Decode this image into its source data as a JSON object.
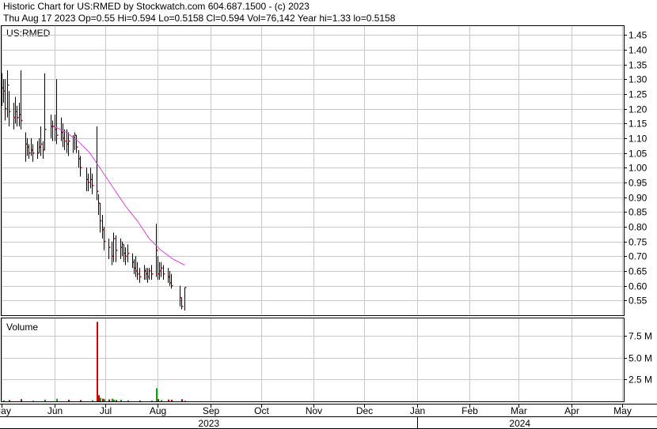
{
  "header": {
    "line1": "Historic Chart for US:RMED by Stockwatch.com 604.687.1500 - (c) 2023",
    "line2": "Thu Aug 17 2023  Op=0.55  Hi=0.594  Lo=0.5158  Cl=0.594  Vol=76,142  Year hi=1.33  lo=0.5158"
  },
  "colors": {
    "background": "#ffffff",
    "grid": "#c8c8c8",
    "candle": "#000000",
    "close_tick": "#cc0000",
    "moving_average": "#e040e0",
    "volume_up": "#cc0000",
    "volume_down": "#00aa00"
  },
  "chart_data": [
    {
      "type": "candlestick",
      "symbol_label": "US:RMED",
      "ylim": [
        0.5,
        1.48
      ],
      "y_ticks": [
        "1.45",
        "1.40",
        "1.35",
        "1.30",
        "1.25",
        "1.20",
        "1.15",
        "1.10",
        "1.05",
        "1.00",
        "0.95",
        "0.90",
        "0.85",
        "0.80",
        "0.75",
        "0.70",
        "0.65",
        "0.60",
        "0.55"
      ],
      "x_months": [
        "May",
        "Jun",
        "Jul",
        "Aug",
        "Sep",
        "Oct",
        "Nov",
        "Dec",
        "Jan",
        "Feb",
        "Mar",
        "Apr",
        "May"
      ],
      "years": [
        "2023",
        "2024"
      ],
      "x_start": "2023-04-30",
      "x_end": "2024-05-01",
      "series": [
        {
          "date": "2023-05-01",
          "high": 1.32,
          "low": 1.21,
          "close": 1.27
        },
        {
          "date": "2023-05-02",
          "high": 1.3,
          "low": 1.22,
          "close": 1.26
        },
        {
          "date": "2023-05-03",
          "high": 1.3,
          "low": 1.16,
          "close": 1.2
        },
        {
          "date": "2023-05-04",
          "high": 1.33,
          "low": 1.17,
          "close": 1.28
        },
        {
          "date": "2023-05-05",
          "high": 1.26,
          "low": 1.14,
          "close": 1.19
        },
        {
          "date": "2023-05-08",
          "high": 1.22,
          "low": 1.13,
          "close": 1.17
        },
        {
          "date": "2023-05-09",
          "high": 1.24,
          "low": 1.15,
          "close": 1.19
        },
        {
          "date": "2023-05-10",
          "high": 1.21,
          "low": 1.14,
          "close": 1.17
        },
        {
          "date": "2023-05-11",
          "high": 1.22,
          "low": 1.14,
          "close": 1.18
        },
        {
          "date": "2023-05-12",
          "high": 1.33,
          "low": 1.13,
          "close": 1.16
        },
        {
          "date": "2023-05-15",
          "high": 1.12,
          "low": 1.02,
          "close": 1.08
        },
        {
          "date": "2023-05-16",
          "high": 1.1,
          "low": 1.04,
          "close": 1.07
        },
        {
          "date": "2023-05-17",
          "high": 1.08,
          "low": 1.03,
          "close": 1.05
        },
        {
          "date": "2023-05-18",
          "high": 1.1,
          "low": 1.04,
          "close": 1.06
        },
        {
          "date": "2023-05-19",
          "high": 1.08,
          "low": 1.02,
          "close": 1.05
        },
        {
          "date": "2023-05-22",
          "high": 1.09,
          "low": 1.03,
          "close": 1.05
        },
        {
          "date": "2023-05-23",
          "high": 1.1,
          "low": 1.05,
          "close": 1.07
        },
        {
          "date": "2023-05-24",
          "high": 1.14,
          "low": 1.04,
          "close": 1.08
        },
        {
          "date": "2023-05-25",
          "high": 1.09,
          "low": 1.03,
          "close": 1.06
        },
        {
          "date": "2023-05-26",
          "high": 1.32,
          "low": 1.06,
          "close": 1.13
        },
        {
          "date": "2023-05-30",
          "high": 1.18,
          "low": 1.1,
          "close": 1.14
        },
        {
          "date": "2023-05-31",
          "high": 1.16,
          "low": 1.09,
          "close": 1.14
        },
        {
          "date": "2023-06-01",
          "high": 1.18,
          "low": 1.09,
          "close": 1.13
        },
        {
          "date": "2023-06-02",
          "high": 1.3,
          "low": 1.08,
          "close": 1.11
        },
        {
          "date": "2023-06-05",
          "high": 1.17,
          "low": 1.09,
          "close": 1.12
        },
        {
          "date": "2023-06-06",
          "high": 1.15,
          "low": 1.07,
          "close": 1.1
        },
        {
          "date": "2023-06-07",
          "high": 1.13,
          "low": 1.06,
          "close": 1.09
        },
        {
          "date": "2023-06-08",
          "high": 1.13,
          "low": 1.05,
          "close": 1.08
        },
        {
          "date": "2023-06-09",
          "high": 1.12,
          "low": 1.04,
          "close": 1.09
        },
        {
          "date": "2023-06-12",
          "high": 1.11,
          "low": 1.05,
          "close": 1.1
        },
        {
          "date": "2023-06-13",
          "high": 1.12,
          "low": 1.06,
          "close": 1.11
        },
        {
          "date": "2023-06-14",
          "high": 1.11,
          "low": 1.05,
          "close": 1.07
        },
        {
          "date": "2023-06-15",
          "high": 1.06,
          "low": 1.0,
          "close": 1.03
        },
        {
          "date": "2023-06-16",
          "high": 1.04,
          "low": 0.97,
          "close": 1.0
        },
        {
          "date": "2023-06-20",
          "high": 1.0,
          "low": 0.92,
          "close": 0.96
        },
        {
          "date": "2023-06-21",
          "high": 0.98,
          "low": 0.92,
          "close": 0.95
        },
        {
          "date": "2023-06-22",
          "high": 1.0,
          "low": 0.93,
          "close": 0.96
        },
        {
          "date": "2023-06-23",
          "high": 0.98,
          "low": 0.91,
          "close": 0.94
        },
        {
          "date": "2023-06-26",
          "high": 1.14,
          "low": 0.89,
          "close": 0.92
        },
        {
          "date": "2023-06-27",
          "high": 0.91,
          "low": 0.84,
          "close": 0.88
        },
        {
          "date": "2023-06-28",
          "high": 0.88,
          "low": 0.78,
          "close": 0.82
        },
        {
          "date": "2023-06-29",
          "high": 0.84,
          "low": 0.76,
          "close": 0.79
        },
        {
          "date": "2023-06-30",
          "high": 0.8,
          "low": 0.72,
          "close": 0.75
        },
        {
          "date": "2023-07-03",
          "high": 0.76,
          "low": 0.69,
          "close": 0.73
        },
        {
          "date": "2023-07-05",
          "high": 0.75,
          "low": 0.67,
          "close": 0.7
        },
        {
          "date": "2023-07-06",
          "high": 0.78,
          "low": 0.68,
          "close": 0.76
        },
        {
          "date": "2023-07-07",
          "high": 0.77,
          "low": 0.68,
          "close": 0.72
        },
        {
          "date": "2023-07-10",
          "high": 0.76,
          "low": 0.69,
          "close": 0.73
        },
        {
          "date": "2023-07-11",
          "high": 0.75,
          "low": 0.7,
          "close": 0.74
        },
        {
          "date": "2023-07-12",
          "high": 0.74,
          "low": 0.68,
          "close": 0.71
        },
        {
          "date": "2023-07-13",
          "high": 0.73,
          "low": 0.67,
          "close": 0.7
        },
        {
          "date": "2023-07-14",
          "high": 0.74,
          "low": 0.68,
          "close": 0.71
        },
        {
          "date": "2023-07-17",
          "high": 0.71,
          "low": 0.66,
          "close": 0.68
        },
        {
          "date": "2023-07-18",
          "high": 0.69,
          "low": 0.64,
          "close": 0.66
        },
        {
          "date": "2023-07-19",
          "high": 0.7,
          "low": 0.63,
          "close": 0.65
        },
        {
          "date": "2023-07-20",
          "high": 0.68,
          "low": 0.62,
          "close": 0.64
        },
        {
          "date": "2023-07-21",
          "high": 0.66,
          "low": 0.61,
          "close": 0.63
        },
        {
          "date": "2023-07-24",
          "high": 0.67,
          "low": 0.62,
          "close": 0.65
        },
        {
          "date": "2023-07-25",
          "high": 0.66,
          "low": 0.62,
          "close": 0.64
        },
        {
          "date": "2023-07-26",
          "high": 0.66,
          "low": 0.61,
          "close": 0.63
        },
        {
          "date": "2023-07-27",
          "high": 0.66,
          "low": 0.62,
          "close": 0.65
        },
        {
          "date": "2023-07-28",
          "high": 0.67,
          "low": 0.62,
          "close": 0.64
        },
        {
          "date": "2023-07-31",
          "high": 0.81,
          "low": 0.63,
          "close": 0.72
        },
        {
          "date": "2023-08-01",
          "high": 0.7,
          "low": 0.62,
          "close": 0.64
        },
        {
          "date": "2023-08-02",
          "high": 0.68,
          "low": 0.62,
          "close": 0.65
        },
        {
          "date": "2023-08-03",
          "high": 0.68,
          "low": 0.63,
          "close": 0.66
        },
        {
          "date": "2023-08-04",
          "high": 0.67,
          "low": 0.62,
          "close": 0.64
        },
        {
          "date": "2023-08-07",
          "high": 0.66,
          "low": 0.61,
          "close": 0.63
        },
        {
          "date": "2023-08-08",
          "high": 0.65,
          "low": 0.6,
          "close": 0.61
        },
        {
          "date": "2023-08-09",
          "high": 0.64,
          "low": 0.59,
          "close": 0.6
        },
        {
          "date": "2023-08-14",
          "high": 0.6,
          "low": 0.53,
          "close": 0.56
        },
        {
          "date": "2023-08-15",
          "high": 0.56,
          "low": 0.52,
          "close": 0.53
        },
        {
          "date": "2023-08-17",
          "high": 0.594,
          "low": 0.5158,
          "close": 0.594
        }
      ],
      "moving_average": [
        {
          "date": "2023-06-01",
          "value": 1.14
        },
        {
          "date": "2023-06-08",
          "value": 1.12
        },
        {
          "date": "2023-06-15",
          "value": 1.09
        },
        {
          "date": "2023-06-22",
          "value": 1.05
        },
        {
          "date": "2023-06-29",
          "value": 0.99
        },
        {
          "date": "2023-07-06",
          "value": 0.93
        },
        {
          "date": "2023-07-13",
          "value": 0.87
        },
        {
          "date": "2023-07-20",
          "value": 0.82
        },
        {
          "date": "2023-07-27",
          "value": 0.76
        },
        {
          "date": "2023-08-03",
          "value": 0.72
        },
        {
          "date": "2023-08-10",
          "value": 0.69
        },
        {
          "date": "2023-08-17",
          "value": 0.67
        }
      ]
    },
    {
      "type": "bar",
      "title": "Volume",
      "ylim": [
        0,
        9500000
      ],
      "y_ticks": [
        {
          "value": 7500000,
          "label": "7.5 M"
        },
        {
          "value": 5000000,
          "label": "5.0 M"
        },
        {
          "value": 2500000,
          "label": "2.5 M"
        }
      ],
      "bars": [
        {
          "date": "2023-05-02",
          "value": 120000,
          "color": "#00aa00"
        },
        {
          "date": "2023-05-05",
          "value": 150000,
          "color": "#cc0000"
        },
        {
          "date": "2023-05-12",
          "value": 250000,
          "color": "#cc0000"
        },
        {
          "date": "2023-05-19",
          "value": 80000,
          "color": "#00aa00"
        },
        {
          "date": "2023-05-26",
          "value": 200000,
          "color": "#00aa00"
        },
        {
          "date": "2023-06-02",
          "value": 300000,
          "color": "#00aa00"
        },
        {
          "date": "2023-06-09",
          "value": 180000,
          "color": "#cc0000"
        },
        {
          "date": "2023-06-16",
          "value": 150000,
          "color": "#cc0000"
        },
        {
          "date": "2023-06-23",
          "value": 120000,
          "color": "#00aa00"
        },
        {
          "date": "2023-06-26",
          "value": 9100000,
          "color": "#cc0000"
        },
        {
          "date": "2023-06-27",
          "value": 700000,
          "color": "#cc0000"
        },
        {
          "date": "2023-06-28",
          "value": 400000,
          "color": "#00aa00"
        },
        {
          "date": "2023-06-29",
          "value": 300000,
          "color": "#cc0000"
        },
        {
          "date": "2023-06-30",
          "value": 250000,
          "color": "#00aa00"
        },
        {
          "date": "2023-07-03",
          "value": 220000,
          "color": "#cc0000"
        },
        {
          "date": "2023-07-05",
          "value": 300000,
          "color": "#00aa00"
        },
        {
          "date": "2023-07-06",
          "value": 200000,
          "color": "#00aa00"
        },
        {
          "date": "2023-07-07",
          "value": 150000,
          "color": "#cc0000"
        },
        {
          "date": "2023-07-10",
          "value": 180000,
          "color": "#00aa00"
        },
        {
          "date": "2023-07-14",
          "value": 120000,
          "color": "#00aa00"
        },
        {
          "date": "2023-07-21",
          "value": 100000,
          "color": "#cc0000"
        },
        {
          "date": "2023-07-28",
          "value": 90000,
          "color": "#00aa00"
        },
        {
          "date": "2023-07-31",
          "value": 1500000,
          "color": "#00aa00"
        },
        {
          "date": "2023-08-01",
          "value": 250000,
          "color": "#cc0000"
        },
        {
          "date": "2023-08-03",
          "value": 150000,
          "color": "#00aa00"
        },
        {
          "date": "2023-08-07",
          "value": 200000,
          "color": "#cc0000"
        },
        {
          "date": "2023-08-09",
          "value": 180000,
          "color": "#cc0000"
        },
        {
          "date": "2023-08-15",
          "value": 250000,
          "color": "#cc0000"
        },
        {
          "date": "2023-08-17",
          "value": 76142,
          "color": "#00aa00"
        }
      ]
    }
  ]
}
